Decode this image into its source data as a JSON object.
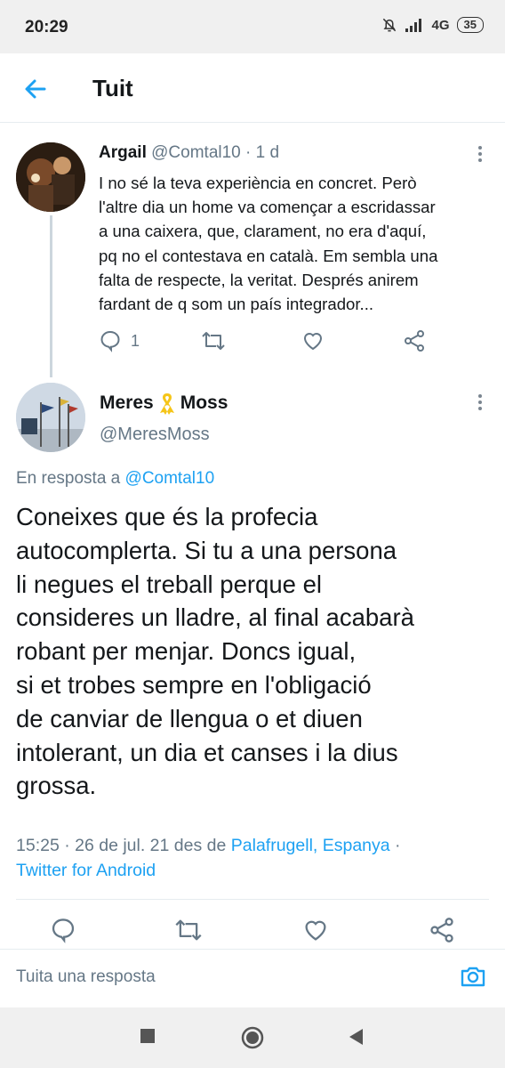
{
  "status_bar": {
    "time": "20:29",
    "network": "4G",
    "battery": "35",
    "icons": [
      "bell-off-icon",
      "signal-icon",
      "battery-icon"
    ]
  },
  "header": {
    "title": "Tuit",
    "back_icon": "arrow-left-icon"
  },
  "parent_tweet": {
    "name": "Argail",
    "handle": "@Comtal10",
    "separator": "·",
    "time": "1 d",
    "text_lines": [
      "I no sé la teva experiència en concret. Però",
      "l'altre dia un home va començar a escridassar",
      "a una caixera, que, clarament, no era d'aquí,",
      "pq no el contestava en català. Em sembla una",
      "falta de respecte, la veritat. Després anirem",
      "fardant de q som un país integrador..."
    ],
    "reply_count": "1"
  },
  "main_tweet": {
    "name_left": "Meres",
    "name_right": "Moss",
    "name_emoji": "yellow-ribbon-icon",
    "handle": "@MeresMoss",
    "reply_prefix": "En resposta a",
    "reply_handle": "@Comtal10",
    "text_lines": [
      "Coneixes que és la profecia",
      "autocomplerta. Si tu a una persona",
      "li negues el treball perque el",
      "consideres un lladre, al final acabarà",
      "robant per menjar. Doncs igual,",
      "si et trobes sempre en l'obligació",
      "de canviar de llengua o et diuen",
      "intolerant, un dia et canses i la dius",
      "grossa."
    ],
    "meta_time": "15:25 · 26 de jul. 21 des de ",
    "meta_location": "Palafrugell, Espanya",
    "meta_dot": " ·",
    "meta_client": "Twitter for Android"
  },
  "compose": {
    "placeholder": "Tuita una resposta",
    "icon": "camera-icon"
  },
  "colors": {
    "accent": "#1da1f2",
    "muted": "#657786",
    "text": "#14171a",
    "ribbon": "#f5c518"
  }
}
